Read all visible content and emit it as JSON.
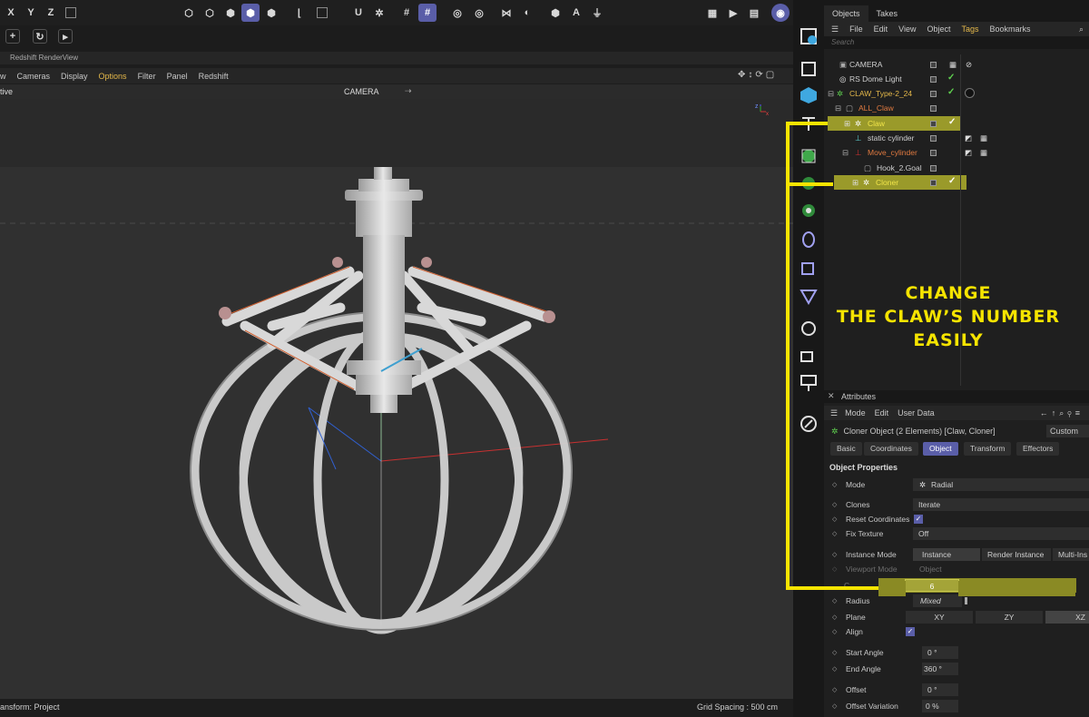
{
  "top_toolbar": {
    "axis_x": "X",
    "axis_y": "Y",
    "axis_z": "Z"
  },
  "renderview": {
    "title": "Redshift RenderView"
  },
  "view_menu": {
    "items": [
      "w",
      "Cameras",
      "Display",
      "Options",
      "Filter",
      "Panel",
      "Redshift"
    ]
  },
  "viewport": {
    "mode_label": "tive",
    "camera_label": "CAMERA"
  },
  "status_bar": {
    "left_text": "ansform: Project",
    "grid_spacing": "Grid Spacing : 500 cm"
  },
  "objects_panel": {
    "tabs": [
      "Objects",
      "Takes"
    ],
    "menu": [
      "File",
      "Edit",
      "View",
      "Object",
      "Tags",
      "Bookmarks"
    ],
    "search_placeholder": "Search",
    "rows": [
      {
        "label": "CAMERA",
        "color": "#d0d0d0"
      },
      {
        "label": "RS Dome Light",
        "color": "#d0d0d0"
      },
      {
        "label": "CLAW_Type-2_24",
        "color": "#e4b84a"
      },
      {
        "label": "ALL_Claw",
        "color": "#e07a40"
      },
      {
        "label": "Claw",
        "color": "#f2e64a"
      },
      {
        "label": "static cylinder",
        "color": "#d0d0d0"
      },
      {
        "label": "Move_cylinder",
        "color": "#e07a40"
      },
      {
        "label": "Hook_2.Goal",
        "color": "#d0d0d0"
      },
      {
        "label": "Cloner",
        "color": "#f2e64a"
      }
    ]
  },
  "attributes_panel": {
    "title": "Attributes",
    "menu": [
      "Mode",
      "Edit",
      "User Data"
    ],
    "object_info": "Cloner Object (2 Elements) [Claw, Cloner]",
    "custom_label": "Custom",
    "tabs": [
      "Basic",
      "Coordinates",
      "Object",
      "Transform",
      "Effectors"
    ],
    "section_title": "Object Properties",
    "fields": {
      "mode": {
        "name": "Mode",
        "value": "Radial"
      },
      "clones": {
        "name": "Clones",
        "value": "Iterate"
      },
      "reset_coordinates": {
        "name": "Reset Coordinates"
      },
      "fix_texture": {
        "name": "Fix Texture",
        "value": "Off"
      },
      "instance_mode": {
        "name": "Instance Mode",
        "options": [
          "Instance",
          "Render Instance",
          "Multi-Ins"
        ]
      },
      "viewport_mode": {
        "name": "Viewport Mode",
        "value": "Object"
      },
      "count": {
        "name": "C",
        "value": "6"
      },
      "radius": {
        "name": "Radius",
        "value": "Mixed"
      },
      "plane": {
        "name": "Plane",
        "options": [
          "XY",
          "ZY",
          "XZ"
        ]
      },
      "align": {
        "name": "Align"
      },
      "start_angle": {
        "name": "Start Angle",
        "value": "0 °"
      },
      "end_angle": {
        "name": "End Angle",
        "value": "360 °"
      },
      "offset": {
        "name": "Offset",
        "value": "0 °"
      },
      "offset_variation": {
        "name": "Offset Variation",
        "value": "0 %"
      }
    }
  },
  "annotation": {
    "line1": "CHANGE",
    "line2": "THE CLAW’S NUMBER",
    "line3": "EASILY",
    "color": "#f6e400"
  }
}
